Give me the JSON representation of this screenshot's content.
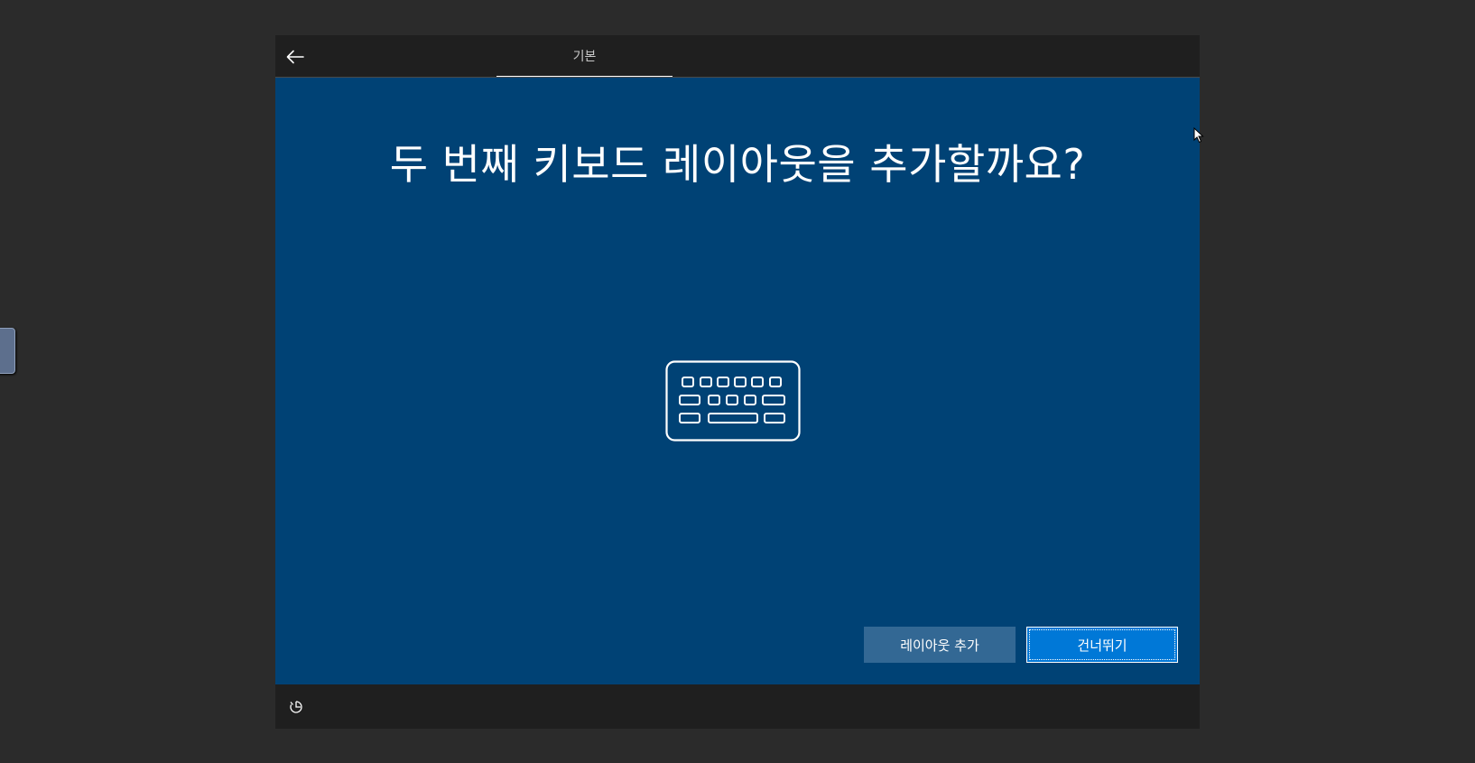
{
  "header": {
    "back_icon": "back-arrow-icon",
    "tab_label": "기본"
  },
  "main": {
    "title": "두 번째 키보드 레이아웃을 추가할까요?",
    "graphic_icon": "keyboard-icon"
  },
  "actions": {
    "add_layout_label": "레이아웃 추가",
    "skip_label": "건너뛰기"
  },
  "footer": {
    "accessibility_icon": "ease-of-access-icon"
  },
  "colors": {
    "content_background": "#004275",
    "primary_button": "#0078d7",
    "secondary_button": "#336894",
    "chrome": "#1f1f1f"
  }
}
